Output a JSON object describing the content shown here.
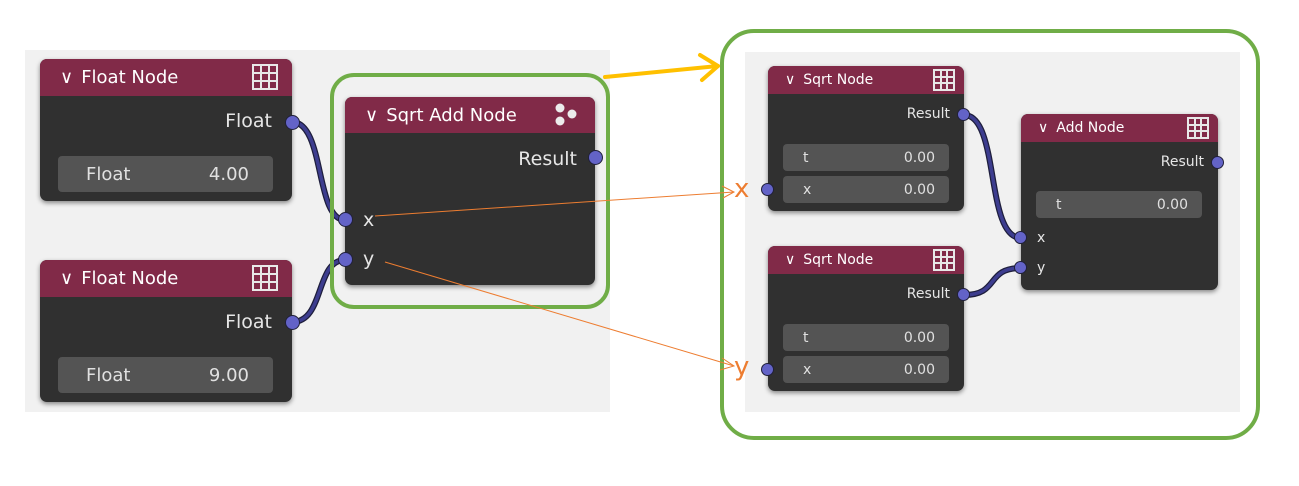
{
  "left": {
    "float_node_1": {
      "title": "Float Node",
      "icon": "grid-icon",
      "output": "Float",
      "field_label": "Float",
      "field_value": "4.00"
    },
    "float_node_2": {
      "title": "Float Node",
      "icon": "grid-icon",
      "output": "Float",
      "field_label": "Float",
      "field_value": "9.00"
    },
    "sqrt_add_node": {
      "title": "Sqrt Add Node",
      "icon": "nodegroup-icon",
      "output": "Result",
      "input_x": "x",
      "input_y": "y"
    }
  },
  "right": {
    "sqrt_node_1": {
      "title": "Sqrt Node",
      "icon": "grid-icon",
      "output": "Result",
      "t_label": "t",
      "t_value": "0.00",
      "x_label": "x",
      "x_value": "0.00"
    },
    "sqrt_node_2": {
      "title": "Sqrt Node",
      "icon": "grid-icon",
      "output": "Result",
      "t_label": "t",
      "t_value": "0.00",
      "x_label": "x",
      "x_value": "0.00"
    },
    "add_node": {
      "title": "Add Node",
      "icon": "grid-icon",
      "output": "Result",
      "t_label": "t",
      "t_value": "0.00",
      "input_x": "x",
      "input_y": "y"
    }
  },
  "annotations": {
    "x": "x",
    "y": "y"
  },
  "colors": {
    "header": "#812a48",
    "node_body": "#303030",
    "socket": "#6363c7",
    "wire": "#3d3d8f",
    "highlight": "#70ad47",
    "arrow": "#ffc000",
    "pointer": "#ed7d31",
    "canvas": "#f1f1f1"
  }
}
